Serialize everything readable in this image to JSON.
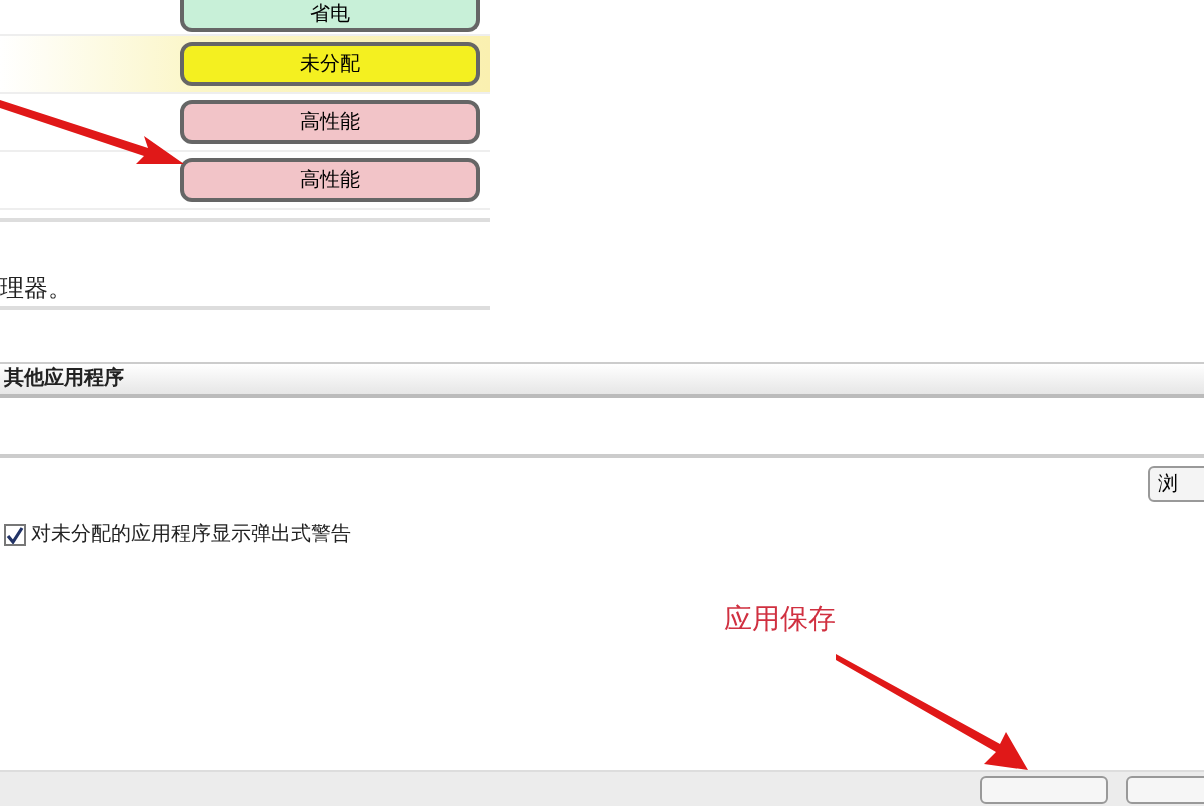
{
  "app_rows": [
    {
      "mode": "省电",
      "color": "#c8f0d8",
      "selected": false
    },
    {
      "mode": "未分配",
      "color": "#f4f020",
      "selected": true
    },
    {
      "mode": "高性能",
      "color": "#f2c4c8",
      "selected": false
    },
    {
      "mode": "高性能",
      "color": "#f2c4c8",
      "selected": false
    }
  ],
  "note": "理器。",
  "other_apps": {
    "header": "其他应用程序",
    "browse_button": "浏"
  },
  "popup_warning": {
    "label": "对未分配的应用程序显示弹出式警告",
    "checked": true
  },
  "annotation": "应用保存"
}
